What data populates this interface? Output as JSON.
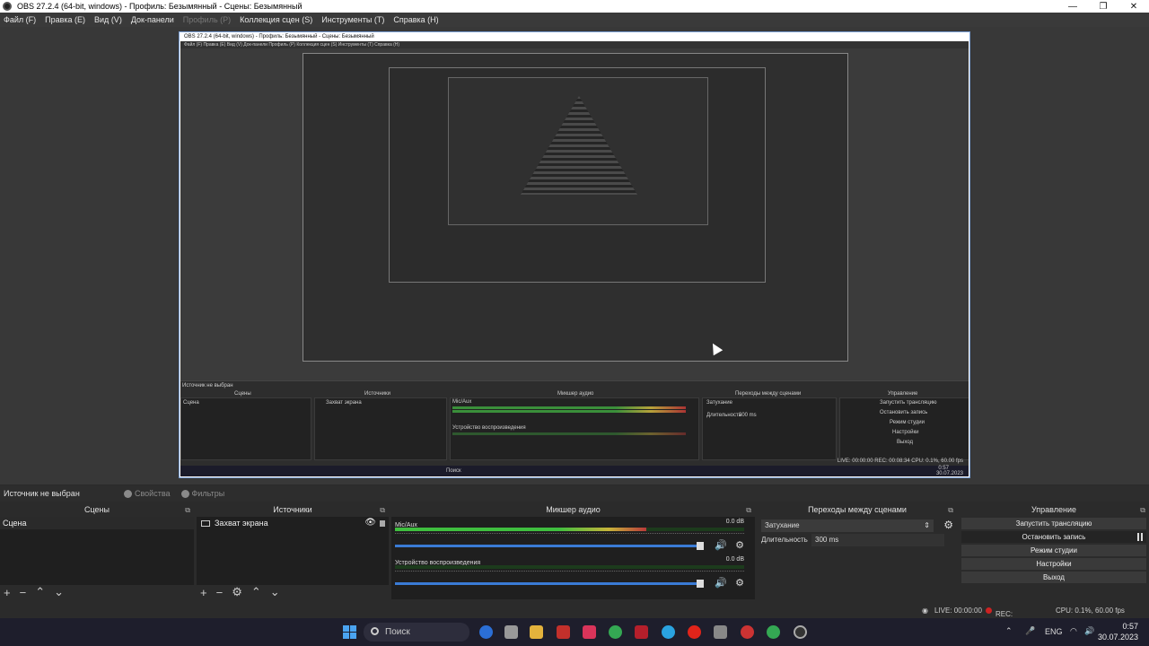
{
  "window": {
    "title": "OBS 27.2.4 (64-bit, windows) - Профиль: Безымянный - Сцены: Безымянный",
    "minimize": "—",
    "maximize": "❐",
    "close": "✕"
  },
  "menu": {
    "file": "Файл (F)",
    "edit": "Правка (E)",
    "view": "Вид (V)",
    "docks": "Док-панели",
    "profile": "Профиль (P)",
    "scene_collection": "Коллекция сцен (S)",
    "tools": "Инструменты (T)",
    "help": "Справка (H)"
  },
  "source_bar": {
    "no_source": "Источник не выбран",
    "properties": "Свойства",
    "filters": "Фильтры"
  },
  "scenes": {
    "title": "Сцены",
    "items": [
      "Сцена"
    ]
  },
  "sources": {
    "title": "Источники",
    "items": [
      "Захват экрана"
    ]
  },
  "mixer": {
    "title": "Микшер аудио",
    "channels": [
      {
        "name": "Mic/Aux",
        "db": "0.0 dB",
        "level": 0.72
      },
      {
        "name": "Устройство воспроизведения",
        "db": "0.0 dB",
        "level": 0.0
      }
    ]
  },
  "transitions": {
    "title": "Переходы между сценами",
    "selected": "Затухание",
    "duration_label": "Длительность",
    "duration_value": "300 ms"
  },
  "controls": {
    "title": "Управление",
    "start_stream": "Запустить трансляцию",
    "stop_recording": "Остановить запись",
    "studio_mode": "Режим студии",
    "settings": "Настройки",
    "exit": "Выход"
  },
  "status": {
    "live": "LIVE: 00:00:00",
    "rec": "REC: 00:08:34",
    "cpu": "CPU: 0.1%, 60.00 fps"
  },
  "taskbar": {
    "search": "Поиск",
    "lang": "ENG",
    "time": "0:57",
    "date": "30.07.2023"
  },
  "nested": {
    "title": "OBS 27.2.4 (64-bit, windows) - Профиль: Безымянный - Сцены: Безымянный",
    "menu": "Файл (F)   Правка (E)   Вид (V)   Док-панели   Профиль (P)   Коллекция сцен (S)   Инструменты (T)   Справка (H)",
    "no_source": "Источник не выбран",
    "scenes": "Сцены",
    "sources": "Источники",
    "mixer": "Микшер аудио",
    "transitions": "Переходы между сценами",
    "controls": "Управление",
    "scene_item": "Сцена",
    "source_item": "Захват экрана",
    "mic": "Mic/Aux",
    "playback": "Устройство воспроизведения",
    "fade": "Затухание",
    "duration": "Длительность",
    "duration_value": "300 ms",
    "start_stream": "Запустить трансляцию",
    "stop_recording": "Остановить запись",
    "studio_mode": "Режим студии",
    "settings": "Настройки",
    "exit": "Выход",
    "status": "LIVE: 00:00:00   REC: 00:08:34   CPU: 0.1%, 60.00 fps",
    "search": "Поиск",
    "time": "0:57",
    "date": "30.07.2023"
  }
}
